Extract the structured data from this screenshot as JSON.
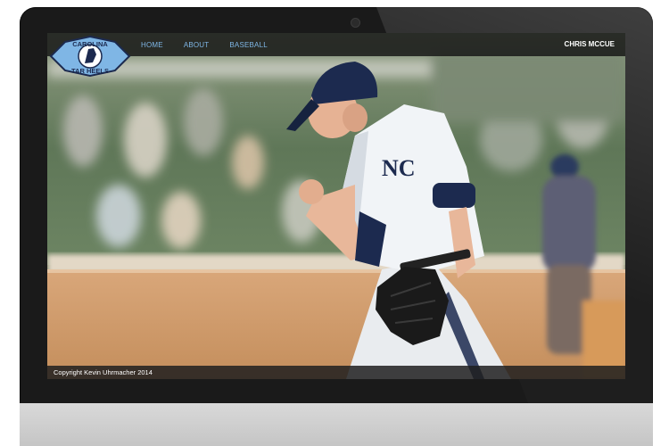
{
  "nav": {
    "links": [
      "HOME",
      "ABOUT",
      "BASEBALL"
    ],
    "brand_name": "CHRIS MCCUE"
  },
  "logo": {
    "text_top": "CAROLINA",
    "text_bottom": "TAR HEELS"
  },
  "footer": {
    "copyright": "Copyright Kevin Uhrmacher 2014"
  },
  "colors": {
    "carolina_blue": "#7fb6e5",
    "navy": "#1c2a4f",
    "bezel": "#1a1a1a"
  }
}
